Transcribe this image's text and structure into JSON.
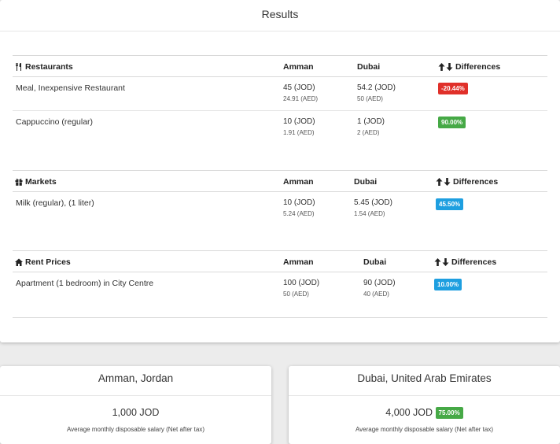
{
  "results": {
    "title": "Results"
  },
  "sections": [
    {
      "category": "Restaurants",
      "icon": "fork-knife-icon",
      "col_city1": "Amman",
      "col_city2": "Dubai",
      "col_diff": "Differences",
      "rows": [
        {
          "name": "Meal, Inexpensive Restaurant",
          "city1_main": "45 (JOD)",
          "city1_sub": "24.91 (AED)",
          "city2_main": "54.2 (JOD)",
          "city2_sub": "50 (AED)",
          "diff": "-20.44%",
          "diff_color": "#e0302a"
        },
        {
          "name": "Cappuccino (regular)",
          "city1_main": "10 (JOD)",
          "city1_sub": "1.91 (AED)",
          "city2_main": "1 (JOD)",
          "city2_sub": "2 (AED)",
          "diff": "90.00%",
          "diff_color": "#46a946"
        }
      ]
    },
    {
      "category": "Markets",
      "icon": "gift-icon",
      "col_city1": "Amman",
      "col_city2": "Dubai",
      "col_diff": "Differences",
      "rows": [
        {
          "name": "Milk (regular), (1 liter)",
          "city1_main": "10 (JOD)",
          "city1_sub": "5.24 (AED)",
          "city2_main": "5.45 (JOD)",
          "city2_sub": "1.54 (AED)",
          "diff": "45.50%",
          "diff_color": "#1e9fe0"
        }
      ]
    },
    {
      "category": "Rent Prices",
      "icon": "home-icon",
      "col_city1": "Amman",
      "col_city2": "Dubai",
      "col_diff": "Differences",
      "rows": [
        {
          "name": "Apartment (1 bedroom) in City Centre",
          "city1_main": "100 (JOD)",
          "city1_sub": "50 (AED)",
          "city2_main": "90 (JOD)",
          "city2_sub": "40 (AED)",
          "diff": "10.00%",
          "diff_color": "#1e9fe0"
        }
      ]
    }
  ],
  "cards": [
    {
      "title": "Amman, Jordan",
      "amount": "1,000 JOD",
      "caption": "Average monthly disposable salary (Net after tax)",
      "badge": ""
    },
    {
      "title": "Dubai, United Arab Emirates",
      "amount": "4,000 JOD",
      "caption": "Average monthly disposable salary (Net after tax)",
      "badge": "75.00%",
      "badge_color": "#46a946"
    }
  ]
}
